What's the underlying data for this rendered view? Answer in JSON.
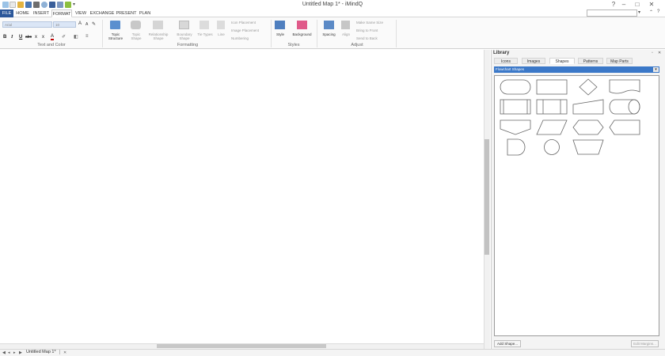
{
  "window": {
    "title": "Untitled Map 1* - iMindQ",
    "minimize": "–",
    "maximize": "□",
    "close": "✕"
  },
  "quick_access": [
    "new-icon",
    "open-icon",
    "save-icon",
    "print-icon",
    "zoom-icon",
    "undo-icon",
    "redo-icon",
    "mark-icon"
  ],
  "tabs": [
    "FILE",
    "HOME",
    "INSERT",
    "FORMAT",
    "VIEW",
    "EXCHANGE",
    "PRESENT",
    "PLAN"
  ],
  "active_tab": "FORMAT",
  "ribbon": {
    "font_name": "Arial",
    "font_size": "10",
    "bold": "B",
    "italic": "I",
    "underline": "U",
    "strikethrough": "abc",
    "subscript": "x",
    "superscript": "x",
    "group_text_and_color": "Text and Color",
    "topic_structure": "Topic Structure",
    "topic_shape": "Topic Shape",
    "relationship_shape": "Relationship Shape",
    "boundary_shape": "Boundary Shape",
    "tie_types": "Tie Types",
    "line": "Line",
    "icon_placement": "Icon Placement",
    "image_placement": "Image Placement",
    "numbering": "Numbering",
    "group_formatting": "Formatting",
    "style": "Style",
    "background": "Background",
    "group_styles": "Styles",
    "spacing": "Spacing",
    "align": "Align",
    "make_same_size": "Make Same Size",
    "bring_to_front": "Bring to Front",
    "send_to_back": "Send to Back",
    "group_adjust": "Adjust"
  },
  "library": {
    "title": "Library",
    "tabs": [
      "Icons",
      "Images",
      "Shapes",
      "Patterns",
      "Map Parts"
    ],
    "active_tab": "Shapes",
    "selected_set": "Flowchart Shapes",
    "add_shape": "Add Shape...",
    "edit_margins": "Edit Margins...",
    "shapes": [
      "terminator",
      "process",
      "decision",
      "document",
      "predefined-process",
      "internal-storage",
      "manual-input",
      "direct-storage",
      "manual-operation",
      "data",
      "preparation",
      "display",
      "delay",
      "connector",
      "loop-limit"
    ]
  },
  "statusbar": {
    "document_tab": "Untitled Map 1*",
    "close": "✕"
  }
}
